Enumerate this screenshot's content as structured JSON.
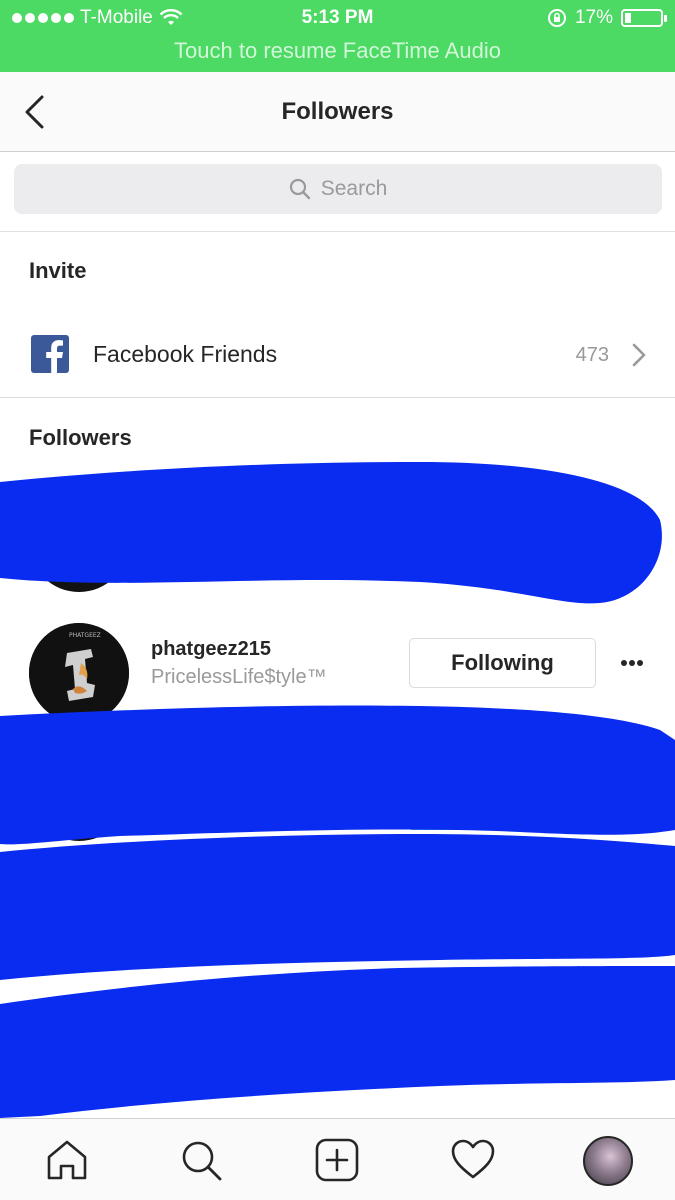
{
  "status_bar": {
    "carrier": "T-Mobile",
    "time": "5:13 PM",
    "battery": "17%",
    "battery_level": 0.17,
    "banner": "Touch to resume FaceTime Audio"
  },
  "nav": {
    "title": "Followers",
    "back_icon": "chevron-left-icon"
  },
  "search": {
    "placeholder": "Search"
  },
  "invite": {
    "heading": "Invite",
    "facebook": {
      "label": "Facebook Friends",
      "count": "473"
    }
  },
  "followers": {
    "heading": "Followers",
    "items": [
      {
        "username": "phatgeez215",
        "full_name": "PricelessLife$tyle™",
        "button": "Following"
      }
    ]
  },
  "tabbar": {
    "icons": [
      "home-icon",
      "search-icon",
      "add-post-icon",
      "heart-icon",
      "profile-avatar"
    ]
  },
  "colors": {
    "status_green": "#4cd964",
    "redaction_blue": "#0a2cf0",
    "follow_blue": "#3897f0",
    "facebook_blue": "#3b5998"
  }
}
